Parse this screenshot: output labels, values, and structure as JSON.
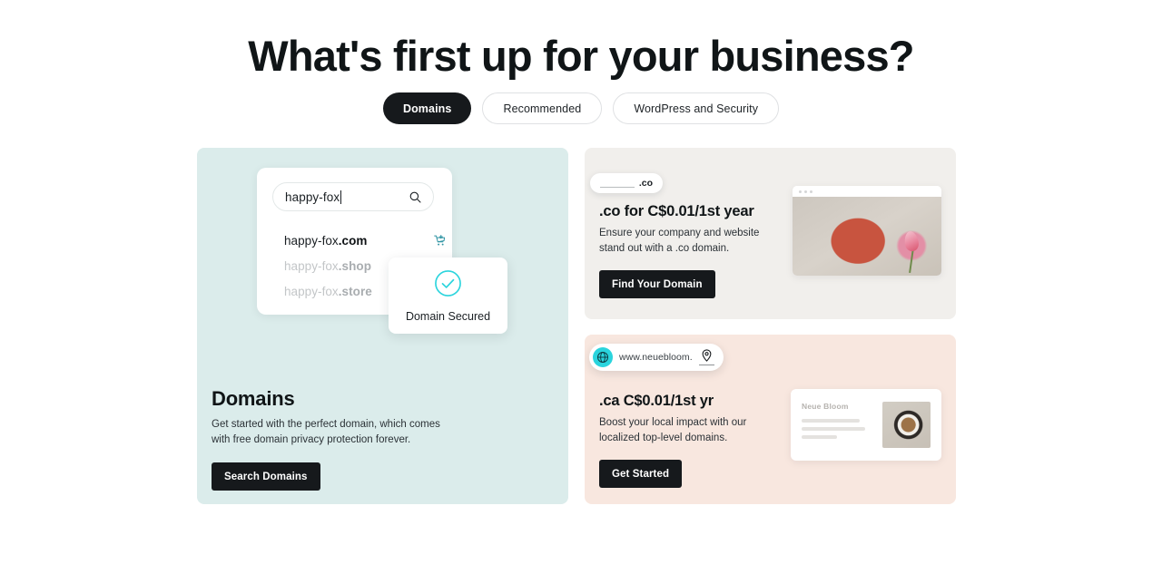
{
  "page": {
    "title": "What's first up for your business?"
  },
  "tabs": [
    {
      "label": "Domains",
      "state": "active"
    },
    {
      "label": "Recommended",
      "state": "idle"
    },
    {
      "label": "WordPress and Security",
      "state": "idle"
    }
  ],
  "domains_card": {
    "background_color": "#dbeceb",
    "search_mock": {
      "input_value": "happy-fox",
      "search_icon": "magnifier-icon",
      "suggestions": [
        {
          "base": "happy-fox",
          "tld": ".com",
          "state": "available",
          "action_icon": "add-to-cart-icon"
        },
        {
          "base": "happy-fox",
          "tld": ".shop",
          "state": "dimmed"
        },
        {
          "base": "happy-fox",
          "tld": ".store",
          "state": "dimmed"
        }
      ]
    },
    "tooltip": {
      "icon": "check-circle-icon",
      "icon_color": "#2ad4dd",
      "label": "Domain Secured"
    },
    "heading": "Domains",
    "description": "Get started with the perfect domain, which comes with free domain privacy protection forever.",
    "cta_label": "Search Domains"
  },
  "co_card": {
    "background_color": "#f1efec",
    "heading": ".co for C$0.01/1st year",
    "description": "Ensure your company and website stand out with a .co domain.",
    "cta_label": "Find Your Domain",
    "mock": {
      "pill_extension": ".co",
      "image_alt": "red ceramic bowl and pink tulip"
    }
  },
  "ca_card": {
    "background_color": "#f8e7df",
    "heading": ".ca C$0.01/1st yr",
    "description": "Boost your local impact with our localized top-level domains.",
    "cta_label": "Get Started",
    "mock": {
      "globe_icon": "globe-icon",
      "globe_color": "#2ad4dd",
      "url_text": "www.neuebloom.",
      "pin_icon": "location-pin-icon",
      "site_title": "Neue Bloom",
      "image_alt": "cup of coffee from above"
    }
  }
}
